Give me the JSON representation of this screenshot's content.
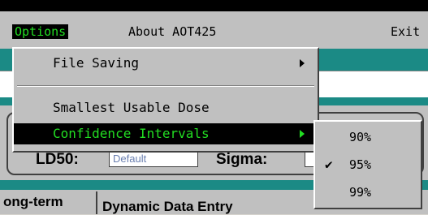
{
  "menubar": {
    "options_label": "Options",
    "about_label": "About AOT425",
    "exit_label": "Exit"
  },
  "background": {
    "ld_label": "LD50:",
    "ld_value": "Default",
    "sigma_label": "Sigma:",
    "tab_label": "ong-term",
    "bottom_text": "Dynamic Data Entry"
  },
  "options_menu": {
    "items": [
      {
        "label": "File Saving",
        "has_submenu": true
      },
      {
        "label": "Smallest Usable Dose",
        "has_submenu": false
      },
      {
        "label": "Confidence Intervals",
        "has_submenu": true,
        "highlighted": true
      }
    ]
  },
  "confidence_submenu": {
    "items": [
      {
        "label": "90%",
        "checked": false
      },
      {
        "label": "95%",
        "checked": true,
        "check_glyph": "✔"
      },
      {
        "label": "99%",
        "checked": false
      }
    ]
  },
  "colors": {
    "menu_highlight_bg": "#000000",
    "menu_highlight_text": "#22dd22",
    "teal": "#1b8a85",
    "panel_gray": "#c0c0c0"
  }
}
